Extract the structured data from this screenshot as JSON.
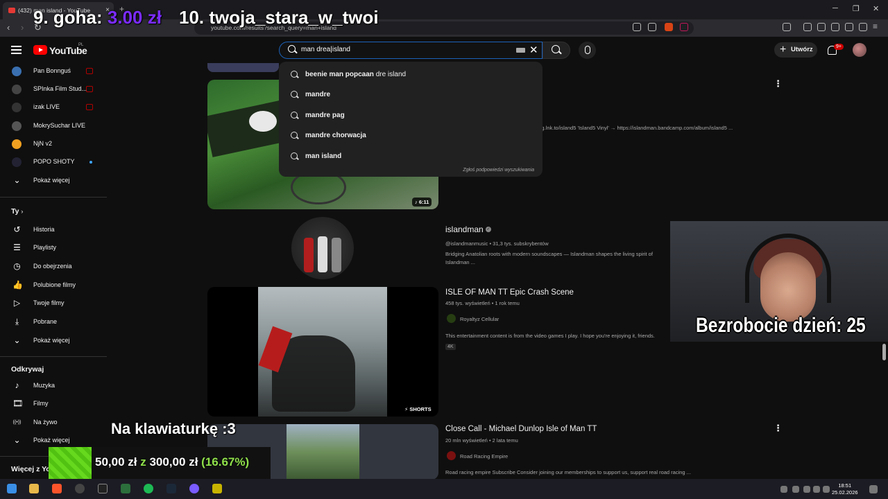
{
  "browser": {
    "tab_title": "(432) man island - YouTube",
    "tab_close": "×",
    "new_tab": "+",
    "url": "youtube.com/results?search_query=man+island",
    "win_min": "─",
    "win_max": "❐",
    "win_close": "✕",
    "back": "‹",
    "forward": "›",
    "reload": "↻"
  },
  "overlay": {
    "rank9_prefix": "9. goha: ",
    "rank9_amount": "3.00 zł",
    "rank10": "10. twoja_stara_w_twoi",
    "webcam_caption": "Bezrobocie dzień: 25",
    "keyboard_text": "Na klawiaturkę :3",
    "goal_current": "50,00 zł",
    "goal_of": "z",
    "goal_target": "300,00 zł",
    "goal_percent": "(16.67%)",
    "goal_progress": 0.1667
  },
  "youtube": {
    "logo_text": "YouTube",
    "region": "PL",
    "search_value": "man drea|island",
    "create_label": "Utwórz",
    "notif_count": "9+",
    "suggestions": [
      {
        "bold": "beenie man popcaan ",
        "normal": "dre island"
      },
      {
        "bold": "mandre",
        "normal": ""
      },
      {
        "bold": "mandre pag",
        "normal": ""
      },
      {
        "bold": "mandre chorwacja",
        "normal": ""
      },
      {
        "bold": "man island",
        "normal": ""
      }
    ],
    "report_text": "Zgłoś podpowiedzi wyszukiwania"
  },
  "sidebar": {
    "subs": [
      {
        "name": "Pan Bonnguś",
        "color": "#3a6fb0",
        "live": true
      },
      {
        "name": "SPInka Film Stud...",
        "color": "#444",
        "live": true
      },
      {
        "name": "izak LIVE",
        "color": "#333",
        "live": true
      },
      {
        "name": "MokrySuchar LIVE",
        "color": "#555",
        "live": false
      },
      {
        "name": "NjN v2",
        "color": "#f0a020",
        "live": false
      },
      {
        "name": "POPO SHOTY",
        "color": "#223",
        "live": false,
        "dot": true
      }
    ],
    "show_more_1": "Pokaż więcej",
    "you_title": "Ty",
    "you_items": [
      "Historia",
      "Playlisty",
      "Do obejrzenia",
      "Polubione filmy",
      "Twoje filmy",
      "Pobrane",
      "Pokaż więcej"
    ],
    "explore_title": "Odkrywaj",
    "explore_items": [
      "Muzyka",
      "Filmy",
      "Na żywo",
      "Pokaż więcej"
    ],
    "more_from": "Więcej z YouTube"
  },
  "results": {
    "r1": {
      "duration": "♪ 6:11",
      "desc": "irginmg.lnk.to/island5 'Island5 Vinyl' → https://islandman.bandcamp.com/album/island5 ..."
    },
    "channel": {
      "name": "islandman",
      "verified": "✓",
      "meta": "@islandmanmusic • 31,3 tys. subskrybentów",
      "desc1": "Bridging Anatolian roots with modern soundscapes — Islandman shapes the living spirit of",
      "desc2": "Islandman ..."
    },
    "r2": {
      "title": "ISLE OF MAN TT Epic Crash Scene",
      "meta": "458 tys. wyświetleń • 1 rok temu",
      "channel": "Royaltyz Cellular",
      "desc": "This entertainment content is from the video games I play. I hope you're enjoying it, friends.",
      "tag": "4K",
      "shorts": "SHORTS"
    },
    "r3": {
      "title": "Close Call - Michael Dunlop Isle of Man TT",
      "meta": "20 mln wyświetleń • 2 lata temu",
      "channel": "Road Racing Empire",
      "desc": "Road racing empire Subscribe Consider joining our memberships to support us, support real road racing ..."
    }
  },
  "taskbar": {
    "time": "18:51",
    "date": "25.02.2026"
  }
}
